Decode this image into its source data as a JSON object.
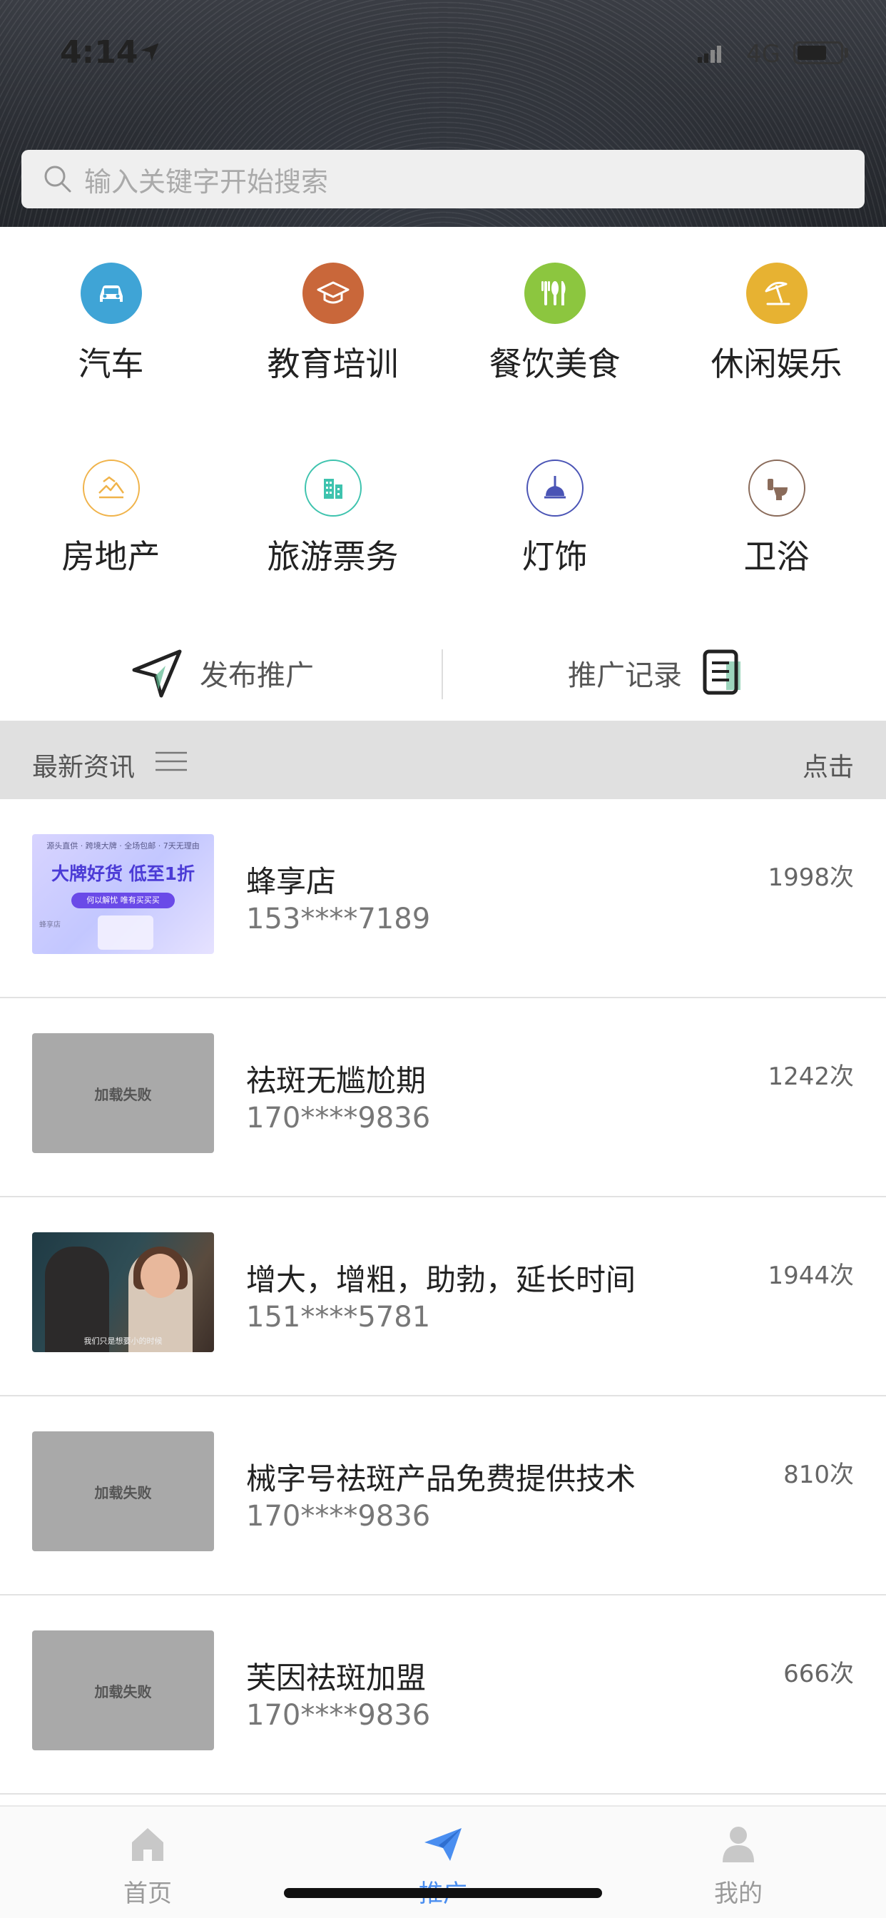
{
  "status_bar": {
    "time": "4:14",
    "network": "4G"
  },
  "search": {
    "placeholder": "输入关键字开始搜索"
  },
  "categories": [
    {
      "label": "汽车",
      "icon": "car-icon",
      "color": "#3fa4d6"
    },
    {
      "label": "教育培训",
      "icon": "graduation-cap-icon",
      "color": "#c9673a"
    },
    {
      "label": "餐饮美食",
      "icon": "fork-knife-icon",
      "color": "#8cc63f"
    },
    {
      "label": "休闲娱乐",
      "icon": "beach-umbrella-icon",
      "color": "#e7b232"
    },
    {
      "label": "房地产",
      "icon": "house-landscape-icon",
      "color": "#f0b34a"
    },
    {
      "label": "旅游票务",
      "icon": "building-icon",
      "color": "#3ec3ae"
    },
    {
      "label": "灯饰",
      "icon": "lamp-icon",
      "color": "#4a54b5"
    },
    {
      "label": "卫浴",
      "icon": "toilet-icon",
      "color": "#8a6b5a"
    }
  ],
  "actions": {
    "publish": "发布推广",
    "records": "推广记录"
  },
  "news": {
    "title": "最新资讯",
    "sort_label": "点击",
    "items": [
      {
        "title": "蜂享店",
        "phone": "153****7189",
        "count": "1998次",
        "thumb": "promo",
        "thumb_text": {
          "top": "源头直供 · 跨境大牌 · 全场包邮 · 7天无理由",
          "main": "大牌好货 低至1折",
          "pill": "何以解忧 唯有买买买",
          "badge": "蜂享店"
        }
      },
      {
        "title": "祛斑无尴尬期",
        "phone": "170****9836",
        "count": "1242次",
        "thumb": "failed",
        "thumb_text": {
          "fail": "加载失败"
        }
      },
      {
        "title": "增大，增粗，助勃，延长时间",
        "phone": "151****5781",
        "count": "1944次",
        "thumb": "movie",
        "thumb_text": {
          "sub": "我们只是想要小的时候"
        }
      },
      {
        "title": "械字号祛斑产品免费提供技术",
        "phone": "170****9836",
        "count": "810次",
        "thumb": "failed",
        "thumb_text": {
          "fail": "加载失败"
        }
      },
      {
        "title": "芙因祛斑加盟",
        "phone": "170****9836",
        "count": "666次",
        "thumb": "failed",
        "thumb_text": {
          "fail": "加载失败"
        }
      }
    ]
  },
  "tabbar": {
    "items": [
      {
        "label": "首页",
        "icon": "home-icon",
        "active": false
      },
      {
        "label": "推广",
        "icon": "paper-plane-icon",
        "active": true
      },
      {
        "label": "我的",
        "icon": "user-icon",
        "active": false
      }
    ],
    "active_color": "#4a8ef0",
    "inactive_color": "#9a9a9a"
  }
}
